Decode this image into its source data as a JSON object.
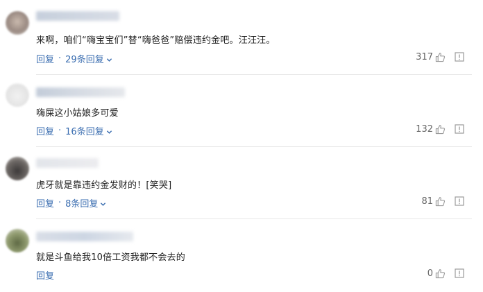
{
  "comments": [
    {
      "text": "来啊，咱们“嗨宝宝们”替“嗨爸爸”赔偿违约金吧。汪汪汪。",
      "reply_label": "回复",
      "replies_label": "29条回复",
      "likes": "317"
    },
    {
      "text": "嗨屎这小姑娘多可爱",
      "reply_label": "回复",
      "replies_label": "16条回复",
      "likes": "132"
    },
    {
      "text": "虎牙就是靠违约金发财的！[笑哭]",
      "reply_label": "回复",
      "replies_label": "8条回复",
      "likes": "81"
    },
    {
      "text": "就是斗鱼给我10倍工资我都不会去的",
      "reply_label": "回复",
      "replies_label": "",
      "likes": "0"
    }
  ],
  "icons": {
    "like": "thumbs-up-icon",
    "report": "report-icon",
    "expand": "chevron-down-icon"
  },
  "colors": {
    "link": "#3a6db0",
    "text": "#222222",
    "count": "#666666",
    "divider": "#e8e8e8"
  }
}
